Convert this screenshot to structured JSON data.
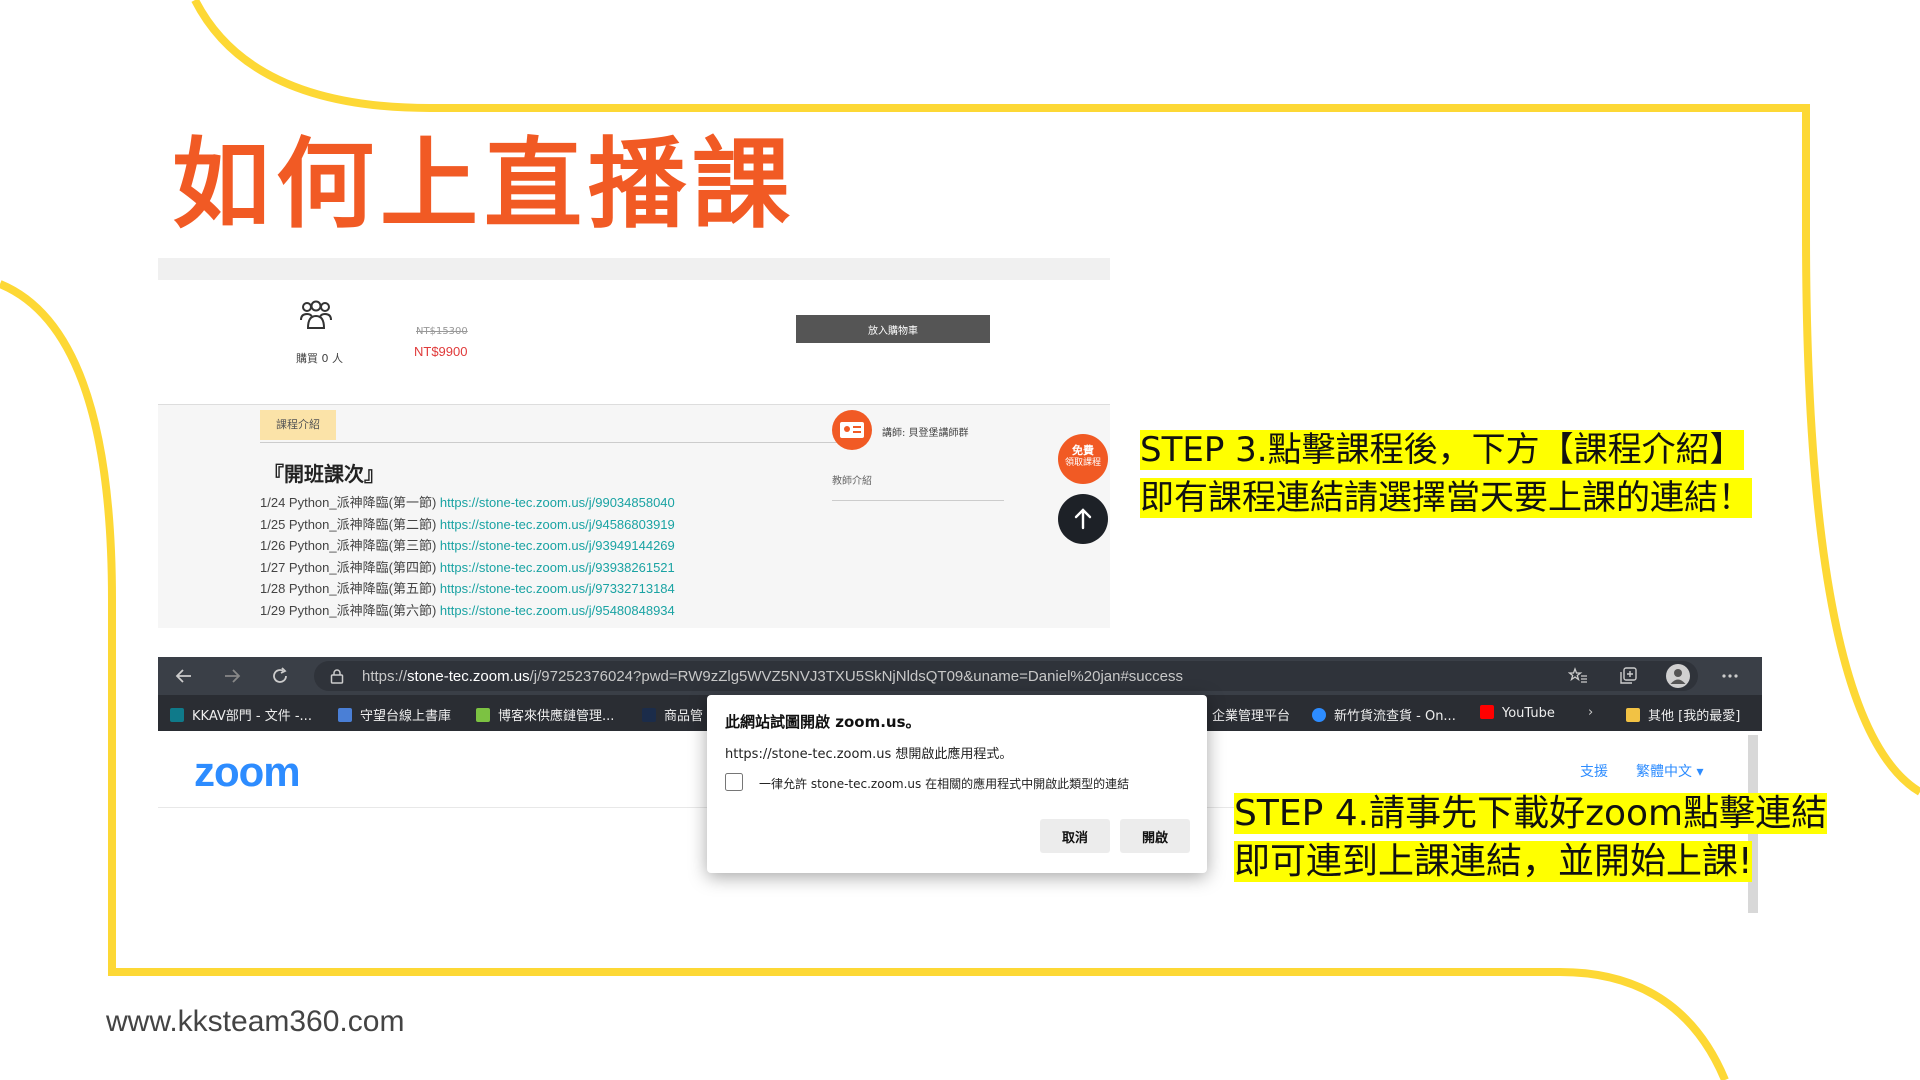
{
  "slide": {
    "title": "如何上直播課",
    "website": "www.kksteam360.com",
    "accent_color": "#f15a24",
    "frame_color": "#fdd835",
    "highlight_color": "#ffff00"
  },
  "course_page": {
    "buyers_label": "購買 0 人",
    "price_original": "NT$15300",
    "price_current": "NT$9900",
    "add_to_cart_label": "放入購物車",
    "intro_tab_label": "課程介紹",
    "schedule_heading": "『開班課次』",
    "sessions": [
      {
        "label": "1/24 Python_派神降臨(第一節) ",
        "url": "https://stone-tec.zoom.us/j/99034858040"
      },
      {
        "label": "1/25 Python_派神降臨(第二節) ",
        "url": "https://stone-tec.zoom.us/j/94586803919"
      },
      {
        "label": "1/26 Python_派神降臨(第三節) ",
        "url": "https://stone-tec.zoom.us/j/93949144269"
      },
      {
        "label": "1/27 Python_派神降臨(第四節) ",
        "url": "https://stone-tec.zoom.us/j/93938261521"
      },
      {
        "label": "1/28 Python_派神降臨(第五節) ",
        "url": "https://stone-tec.zoom.us/j/97332713184"
      },
      {
        "label": "1/29 Python_派神降臨(第六節) ",
        "url": "https://stone-tec.zoom.us/j/95480848934"
      }
    ],
    "teacher_name": "講師: 貝登堡講師群",
    "teacher_intro_label": "教師介紹",
    "free_badge_main": "免費",
    "free_badge_sub": "領取課程"
  },
  "callouts": {
    "step3_line1": "STEP 3.點擊課程後，下方【課程介紹】",
    "step3_line2": "即有課程連結請選擇當天要上課的連結！",
    "step4_line1": "STEP 4.請事先下載好zoom點擊連結",
    "step4_line2": "即可連到上課連結，並開始上課!"
  },
  "browser": {
    "url_prefix": "https://",
    "url_host": "stone-tec.zoom.us",
    "url_path": "/j/97252376024?pwd=RW9zZlg5WVZ5NVJ3TXU5SkNjNldsQT09&uname=Daniel%20jan#success",
    "bookmarks": [
      "KKAV部門 - 文件 -...",
      "守望台線上書庫",
      "博客來供應鏈管理...",
      "商品管",
      "企業管理平台",
      "新竹貨流查貨 - On...",
      "YouTube",
      "其他 [我的最愛]"
    ],
    "zoom_logo": "zoom",
    "support_link": "支援",
    "language": "繁體中文 ▾",
    "dialog": {
      "title": "此網站試圖開啟 zoom.us。",
      "message": "https://stone-tec.zoom.us 想開啟此應用程式。",
      "checkbox_label": "一律允許 stone-tec.zoom.us 在相關的應用程式中開啟此類型的連結",
      "cancel_label": "取消",
      "open_label": "開啟"
    }
  }
}
